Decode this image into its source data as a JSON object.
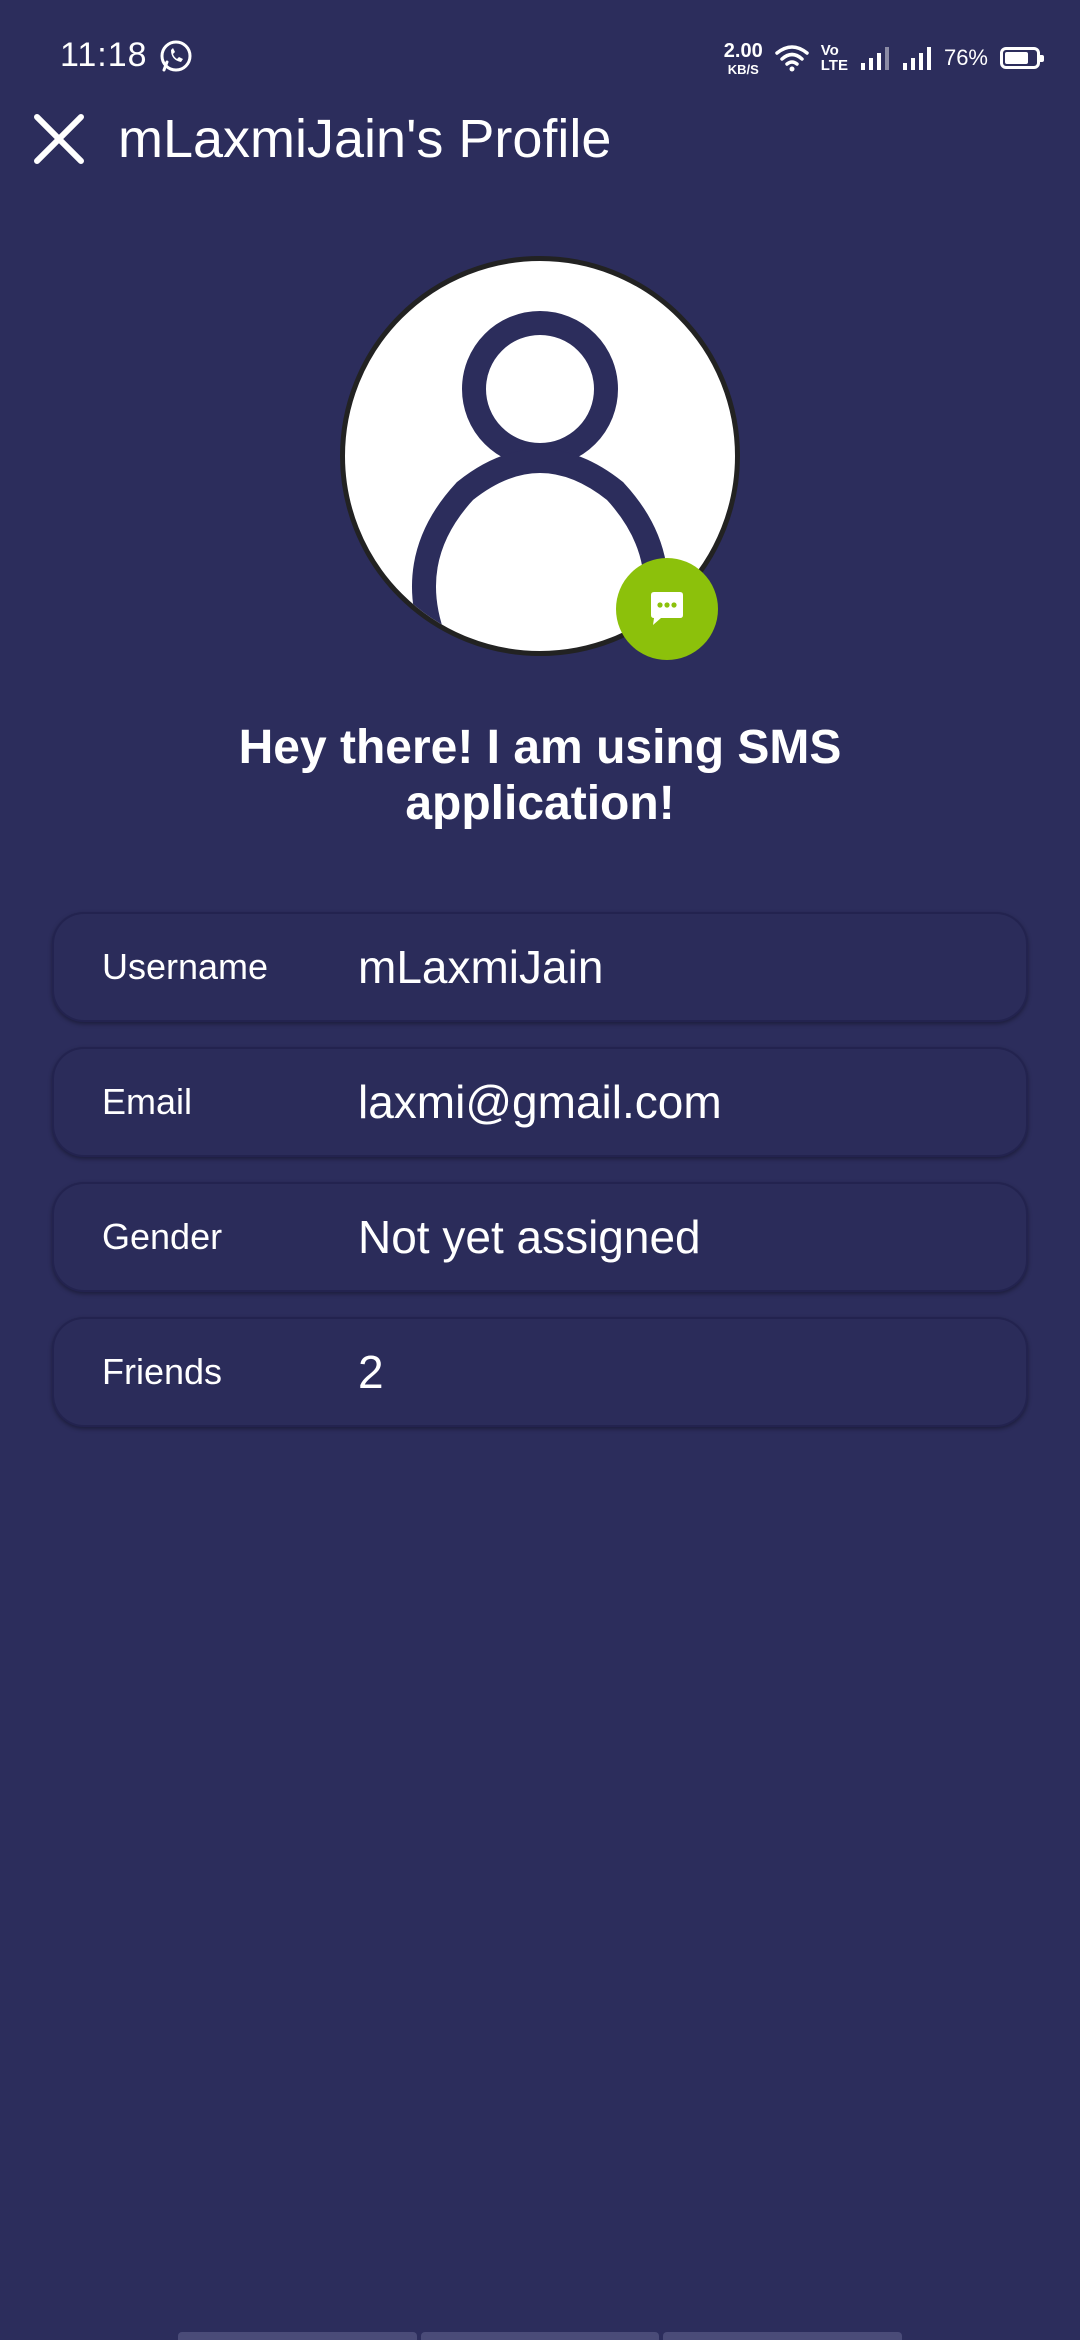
{
  "status_bar": {
    "time": "11:18",
    "net_speed_value": "2.00",
    "net_speed_unit": "KB/S",
    "volte_top": "Vo",
    "volte_bottom": "LTE",
    "battery_percent": "76%",
    "battery_level": 0.76,
    "icons": [
      "whatsapp-icon",
      "wifi-icon",
      "signal-icon",
      "signal-icon",
      "battery-icon"
    ]
  },
  "header": {
    "title": "mLaxmiJain's Profile",
    "close_icon": "close-icon"
  },
  "profile": {
    "avatar_icon": "person-icon",
    "chat_icon": "chat-bubble-icon",
    "status_message": "Hey there! I am using SMS application!"
  },
  "info": {
    "rows": [
      {
        "label": "Username",
        "value": "mLaxmiJain"
      },
      {
        "label": "Email",
        "value": "laxmi@gmail.com"
      },
      {
        "label": "Gender",
        "value": "Not yet assigned"
      },
      {
        "label": "Friends",
        "value": "2"
      }
    ]
  },
  "colors": {
    "background": "#2c2d5c",
    "accent_green": "#8cc10b",
    "text": "#ffffff"
  }
}
